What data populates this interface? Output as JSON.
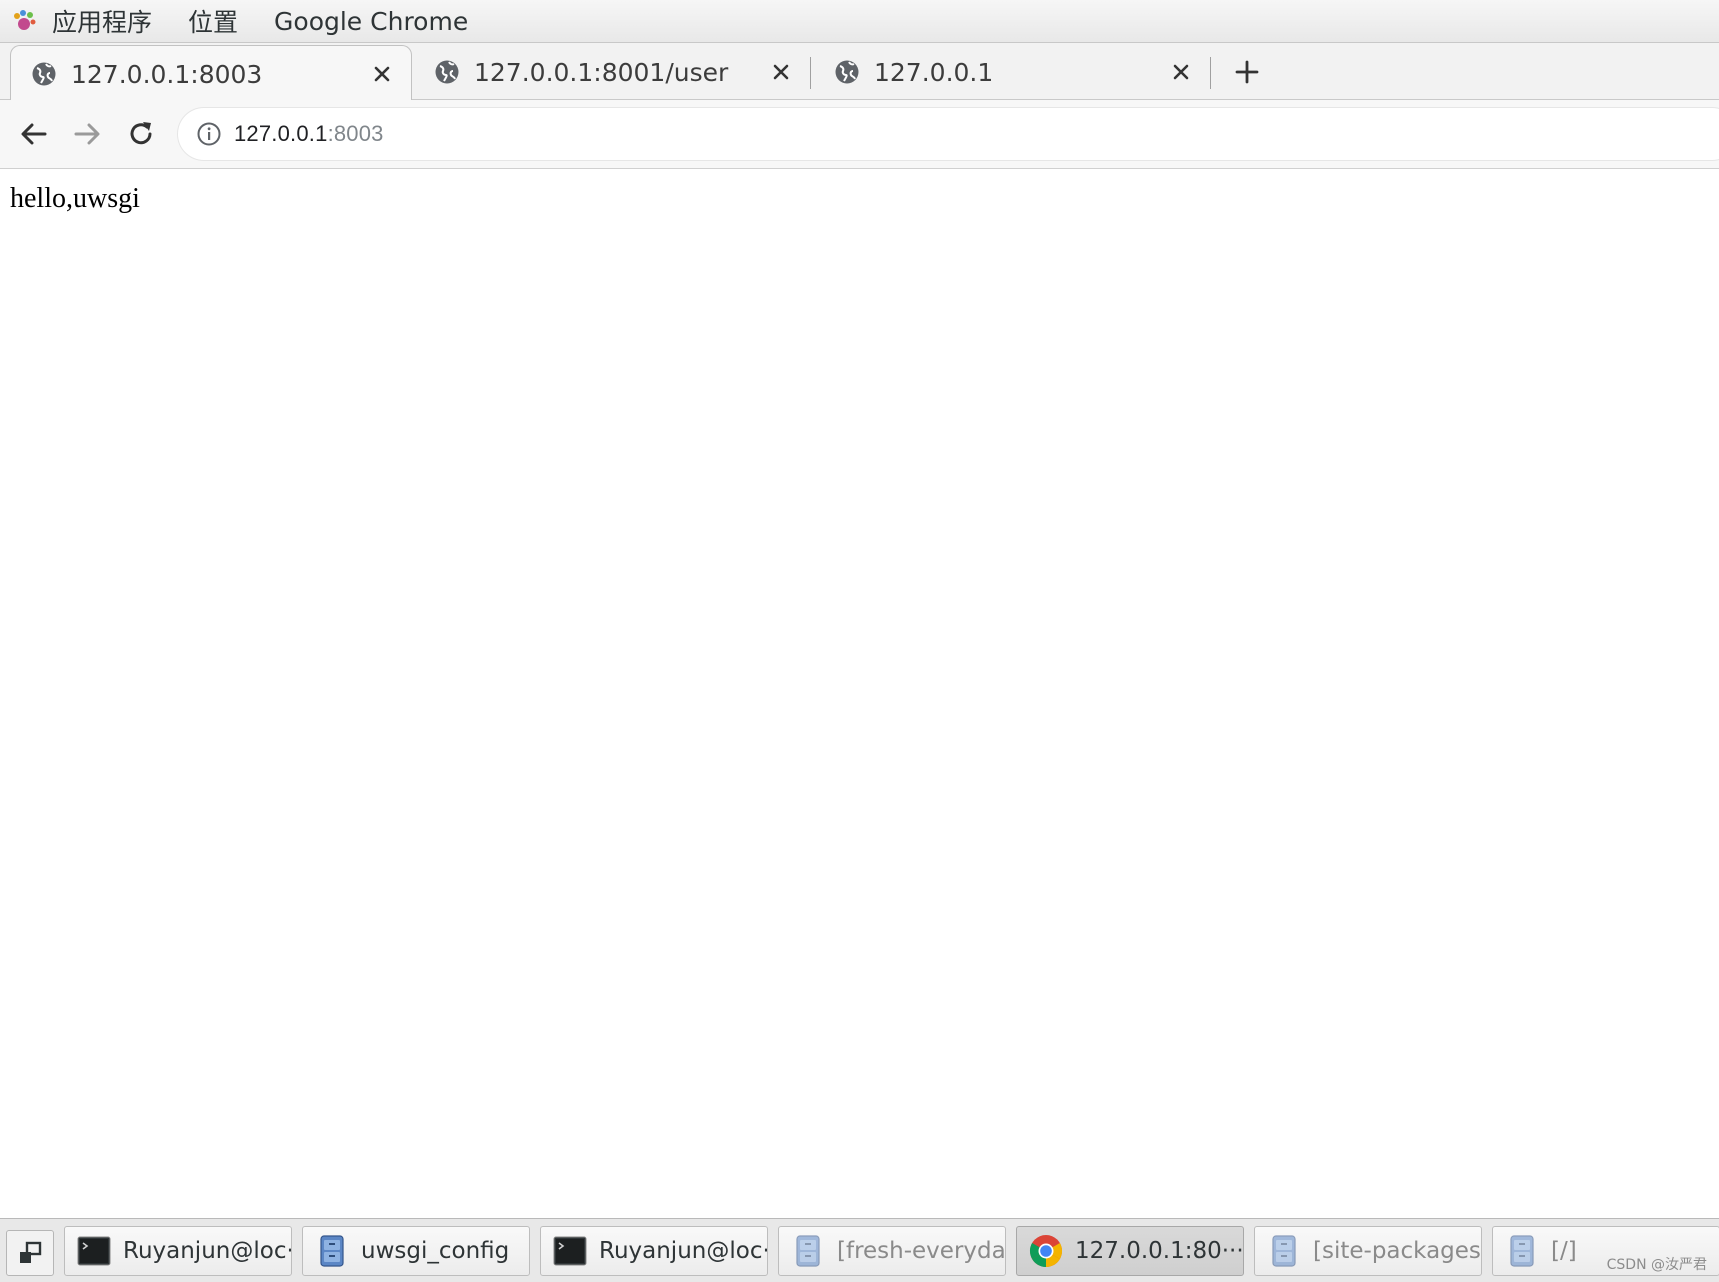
{
  "top_panel": {
    "menus": [
      "应用程序",
      "位置",
      "Google Chrome"
    ]
  },
  "tabs": [
    {
      "title": "127.0.0.1:8003",
      "active": true
    },
    {
      "title": "127.0.0.1:8001/user",
      "active": false
    },
    {
      "title": "127.0.0.1",
      "active": false
    }
  ],
  "omnibox": {
    "url_host": "127.0.0.1",
    "url_port": ":8003"
  },
  "page": {
    "body_text": "hello,uwsgi"
  },
  "taskbar": {
    "items": [
      {
        "label": "Ruyanjun@loc···",
        "icon": "terminal-icon",
        "state": "normal"
      },
      {
        "label": "uwsgi_config",
        "icon": "file-cabinet-icon",
        "state": "normal"
      },
      {
        "label": "Ruyanjun@loc···",
        "icon": "terminal-icon",
        "state": "normal"
      },
      {
        "label": "[fresh-everyday]",
        "icon": "file-cabinet-icon",
        "state": "minimized"
      },
      {
        "label": "127.0.0.1:80···",
        "icon": "chrome-icon",
        "state": "active"
      },
      {
        "label": "[site-packages]",
        "icon": "file-cabinet-icon",
        "state": "minimized"
      },
      {
        "label": "[/]",
        "icon": "file-cabinet-icon",
        "state": "minimized"
      }
    ],
    "watermark": "CSDN @汝严君"
  },
  "colors": {
    "panel_bg": "#ececec",
    "tab_bg": "#f2f2f2",
    "omnibox_bg": "#ffffff",
    "url_port": "#80868b",
    "chrome_red": "#db4437",
    "chrome_green": "#0f9d58",
    "chrome_yellow": "#f4b400",
    "chrome_blue": "#4285f4"
  }
}
